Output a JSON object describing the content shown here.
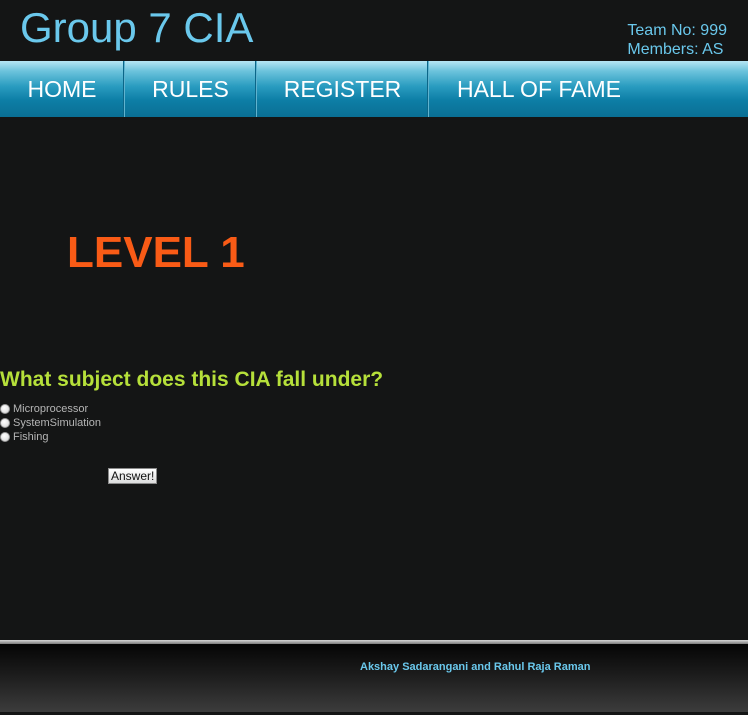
{
  "header": {
    "site_title": "Group 7 CIA",
    "team_no": "Team No: 999",
    "members": "Members: AS"
  },
  "nav": {
    "items": [
      {
        "label": "HOME"
      },
      {
        "label": "RULES"
      },
      {
        "label": "REGISTER"
      },
      {
        "label": "HALL OF FAME"
      }
    ]
  },
  "main": {
    "level_title": "LEVEL 1",
    "question": "What subject does this CIA fall under?",
    "options": [
      {
        "label": "Microprocessor",
        "selected": false
      },
      {
        "label": "SystemSimulation",
        "selected": false
      },
      {
        "label": "Fishing",
        "selected": false
      }
    ],
    "answer_button": "Answer!"
  },
  "footer": {
    "credits": "Akshay Sadarangani and Rahul Raja Raman"
  },
  "colors": {
    "background": "#141515",
    "title_blue": "#6ac8ec",
    "level_orange": "#f95b16",
    "question_green": "#b6e03a"
  }
}
